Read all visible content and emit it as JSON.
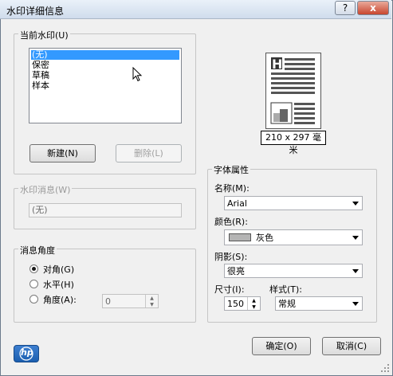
{
  "window": {
    "title": "水印详细信息",
    "help_button": "?",
    "close_button": "x"
  },
  "current_watermark": {
    "label": "当前水印(U)",
    "items": [
      "(无)",
      "保密",
      "草稿",
      "样本"
    ],
    "selected_index": 0,
    "new_button": "新建(N)",
    "delete_button": "删除(L)"
  },
  "watermark_message": {
    "label": "水印消息(W)",
    "value": "(无)"
  },
  "message_angle": {
    "label": "消息角度",
    "options": [
      "对角(G)",
      "水平(H)",
      "角度(A):"
    ],
    "selected_index": 0,
    "angle_value": "0"
  },
  "preview": {
    "size_label": "210 x 297 毫米"
  },
  "font_attributes": {
    "label": "字体属性",
    "name_label": "名称(M):",
    "name_value": "Arial",
    "color_label": "颜色(R):",
    "color_value": "灰色",
    "color_swatch": "#b4b4b4",
    "shading_label": "阴影(S):",
    "shading_value": "很亮",
    "size_label": "尺寸(I):",
    "size_value": "150",
    "style_label": "样式(T):",
    "style_value": "常规"
  },
  "footer": {
    "logo_text": "hp",
    "ok_button": "确定(O)",
    "cancel_button": "取消(C)"
  },
  "colors": {
    "selection": "#3399ff",
    "hp_blue": "#1c5fb0"
  }
}
